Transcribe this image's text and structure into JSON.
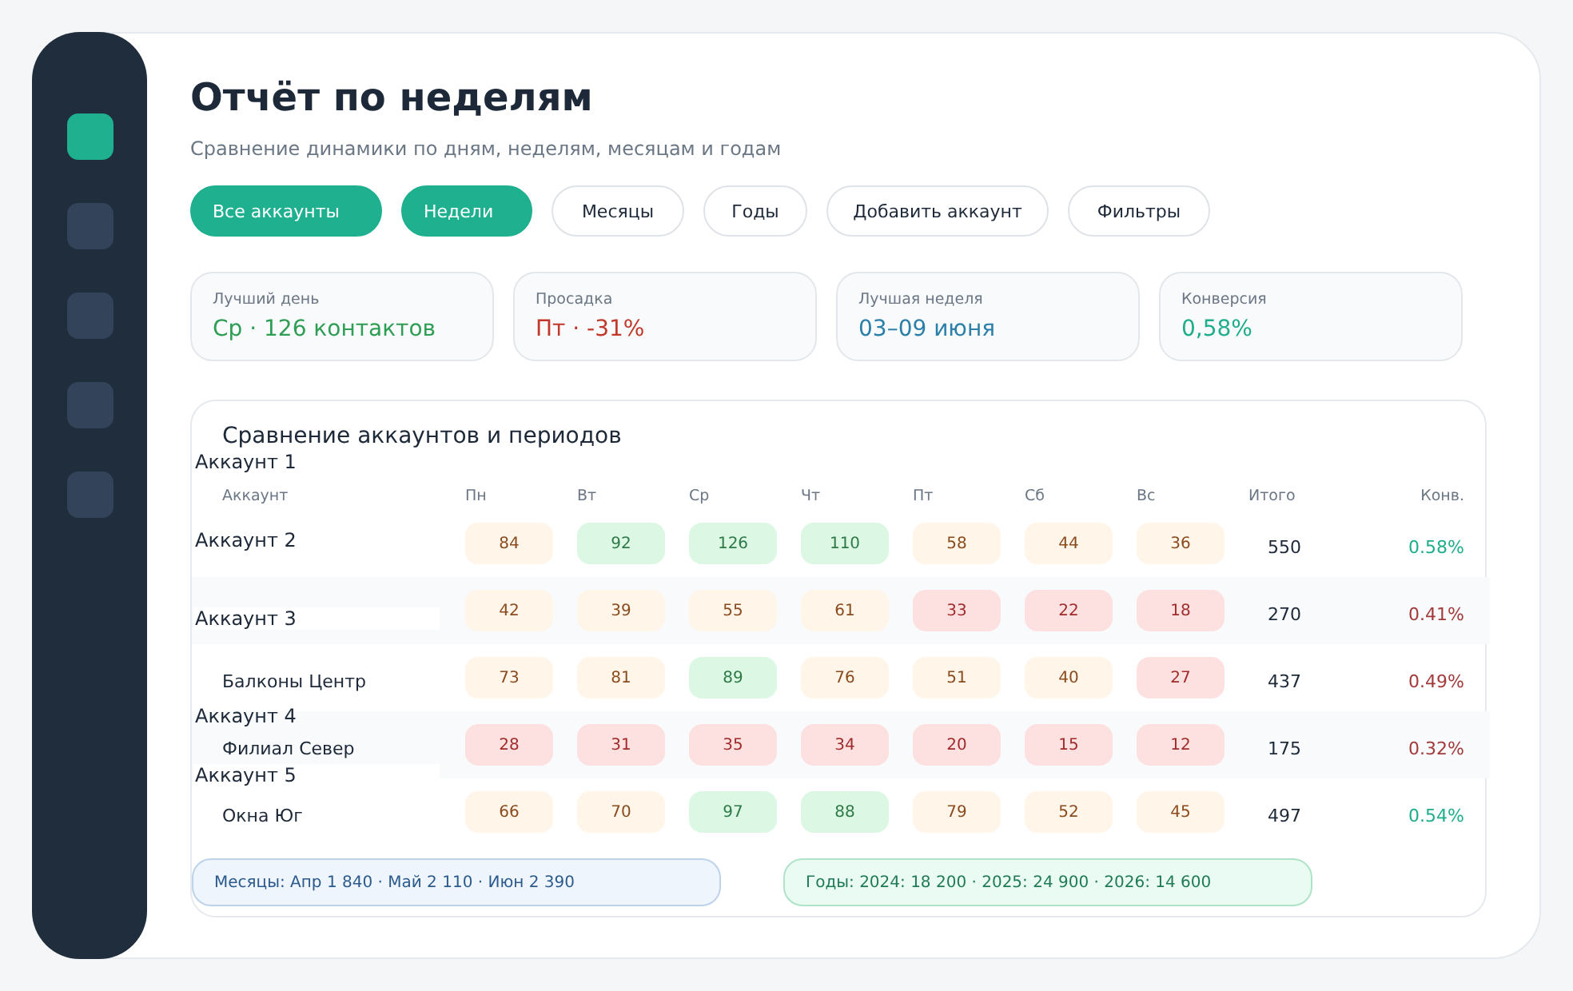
{
  "sidebar": {
    "items": [
      {
        "selected": true
      },
      {
        "selected": false
      },
      {
        "selected": false
      },
      {
        "selected": false
      },
      {
        "selected": false
      }
    ]
  },
  "header": {
    "title": "Отчёт по неделям",
    "subtitle": "Сравнение динамики по дням, неделям, месяцам и годам"
  },
  "toolbar": [
    {
      "label": "Все аккаунты",
      "selected": true
    },
    {
      "label": "Недели",
      "selected": true
    },
    {
      "label": "Месяцы",
      "selected": false
    },
    {
      "label": "Годы",
      "selected": false
    },
    {
      "label": "Добавить аккаунт",
      "selected": false
    },
    {
      "label": "Фильтры",
      "selected": false
    }
  ],
  "stats": [
    {
      "label": "Лучший день",
      "value": "Ср · 126 контактов",
      "color": "#2f9e55"
    },
    {
      "label": "Просадка",
      "value": "Пт · -31%",
      "color": "#c0392b"
    },
    {
      "label": "Лучшая неделя",
      "value": "03–09 июня",
      "color": "#2b7fa8"
    },
    {
      "label": "Конверсия",
      "value": "0,58%",
      "color": "#1fae8c"
    }
  ],
  "table": {
    "title": "Сравнение аккаунтов и периодов",
    "overlay_labels": [
      "Аккаунт 1",
      "Аккаунт 2",
      "Аккаунт 3",
      "Аккаунт 4",
      "Аккаунт 5"
    ],
    "columns": [
      "Аккаунт",
      "Пн",
      "Вт",
      "Ср",
      "Чт",
      "Пт",
      "Сб",
      "Вс",
      "Итого",
      "Конв."
    ],
    "rows": [
      {
        "cells": [
          {
            "v": "84",
            "color": "#fff5e8"
          },
          {
            "v": "92",
            "color": "#dcf7e3"
          },
          {
            "v": "126",
            "color": "#dcf7e3"
          },
          {
            "v": "110",
            "color": "#dcf7e3"
          },
          {
            "v": "58",
            "color": "#fff5e8"
          },
          {
            "v": "44",
            "color": "#fff5e8"
          },
          {
            "v": "36",
            "color": "#fff5e8"
          }
        ],
        "total": "550",
        "conversion": {
          "text": "0.58%",
          "color": "#1fae8c"
        }
      },
      {
        "cells": [
          {
            "v": "42",
            "color": "#fff5e8"
          },
          {
            "v": "39",
            "color": "#fff5e8"
          },
          {
            "v": "55",
            "color": "#fff5e8"
          },
          {
            "v": "61",
            "color": "#fff5e8"
          },
          {
            "v": "33",
            "color": "#fde1e1"
          },
          {
            "v": "22",
            "color": "#fde1e1"
          },
          {
            "v": "18",
            "color": "#fde1e1"
          }
        ],
        "total": "270",
        "conversion": {
          "text": "0.41%",
          "color": "#a33a3a"
        }
      },
      {
        "name": "Балконы Центр",
        "cells": [
          {
            "v": "73",
            "color": "#fff5e8"
          },
          {
            "v": "81",
            "color": "#fff5e8"
          },
          {
            "v": "89",
            "color": "#dcf7e3"
          },
          {
            "v": "76",
            "color": "#fff5e8"
          },
          {
            "v": "51",
            "color": "#fff5e8"
          },
          {
            "v": "40",
            "color": "#fff5e8"
          },
          {
            "v": "27",
            "color": "#fde1e1"
          }
        ],
        "total": "437",
        "conversion": {
          "text": "0.49%",
          "color": "#a33a3a"
        }
      },
      {
        "name": "Филиал Север",
        "cells": [
          {
            "v": "28",
            "color": "#fde1e1"
          },
          {
            "v": "31",
            "color": "#fde1e1"
          },
          {
            "v": "35",
            "color": "#fde1e1"
          },
          {
            "v": "34",
            "color": "#fde1e1"
          },
          {
            "v": "20",
            "color": "#fde1e1"
          },
          {
            "v": "15",
            "color": "#fde1e1"
          },
          {
            "v": "12",
            "color": "#fde1e1"
          }
        ],
        "total": "175",
        "conversion": {
          "text": "0.32%",
          "color": "#a33a3a"
        }
      },
      {
        "name": "Окна Юг",
        "cells": [
          {
            "v": "66",
            "color": "#fff5e8"
          },
          {
            "v": "70",
            "color": "#fff5e8"
          },
          {
            "v": "97",
            "color": "#dcf7e3"
          },
          {
            "v": "88",
            "color": "#dcf7e3"
          },
          {
            "v": "79",
            "color": "#fff5e8"
          },
          {
            "v": "52",
            "color": "#fff5e8"
          },
          {
            "v": "45",
            "color": "#fff5e8"
          }
        ],
        "total": "497",
        "conversion": {
          "text": "0.54%",
          "color": "#1fae8c"
        }
      }
    ],
    "summaries": [
      {
        "kind": "months",
        "text": "Месяцы: Апр 1 840 · Май 2 110 · Июн 2 390"
      },
      {
        "kind": "years",
        "text": "Годы: 2024: 18 200 · 2025: 24 900 · 2026: 14 600"
      }
    ]
  }
}
